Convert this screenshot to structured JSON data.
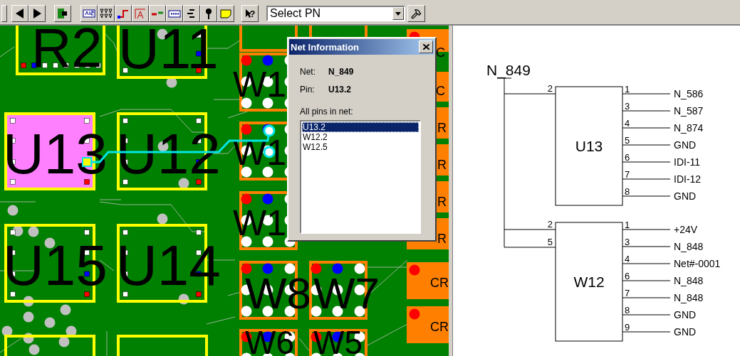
{
  "toolbar": {
    "help_glyph": "?",
    "part_select": {
      "value": "Select PN"
    }
  },
  "pcb": {
    "components": [
      {
        "label": "R2",
        "kind": "resistor_network",
        "selected": false
      },
      {
        "label": "U11",
        "kind": "ic",
        "selected": false
      },
      {
        "label": "U13",
        "kind": "ic",
        "selected": true
      },
      {
        "label": "U12",
        "kind": "ic",
        "selected": false
      },
      {
        "label": "U15",
        "kind": "ic",
        "selected": false
      },
      {
        "label": "U14",
        "kind": "ic",
        "selected": false
      },
      {
        "label": "W1",
        "kind": "header",
        "selected": false
      },
      {
        "label": "W1",
        "kind": "header",
        "selected": false
      },
      {
        "label": "W1",
        "kind": "header",
        "selected": false
      },
      {
        "label": "W8",
        "kind": "header",
        "selected": false
      },
      {
        "label": "W7",
        "kind": "header",
        "selected": false
      },
      {
        "label": "W6",
        "kind": "header",
        "selected": false
      },
      {
        "label": "W5",
        "kind": "header",
        "selected": false
      },
      {
        "label": "C",
        "kind": "diode",
        "selected": false
      },
      {
        "label": "C",
        "kind": "diode",
        "selected": false
      },
      {
        "label": "R",
        "kind": "diode",
        "selected": false
      },
      {
        "label": "R",
        "kind": "diode",
        "selected": false
      },
      {
        "label": "R",
        "kind": "diode",
        "selected": false
      },
      {
        "label": "R",
        "kind": "diode",
        "selected": false
      },
      {
        "label": "CR",
        "kind": "diode",
        "selected": false
      },
      {
        "label": "CR",
        "kind": "diode",
        "selected": false
      }
    ]
  },
  "net_dialog": {
    "title": "Net Information",
    "net_label": "Net:",
    "net": "N_849",
    "pin_label": "Pin:",
    "pin": "U13.2",
    "list_label": "All pins in net:",
    "pins": [
      {
        "name": "U13.2",
        "selected": true
      },
      {
        "name": "W12.2",
        "selected": false
      },
      {
        "name": "W12.5",
        "selected": false
      }
    ]
  },
  "schematic": {
    "net_label": "N_849",
    "parts": [
      {
        "name": "U13",
        "left_pins": [
          {
            "number": "2"
          }
        ],
        "right_pins": [
          {
            "number": "1",
            "net": "N_586"
          },
          {
            "number": "3",
            "net": "N_587"
          },
          {
            "number": "4",
            "net": "N_874"
          },
          {
            "number": "5",
            "net": "GND"
          },
          {
            "number": "6",
            "net": "IDI-11"
          },
          {
            "number": "7",
            "net": "IDI-12"
          },
          {
            "number": "8",
            "net": "GND"
          }
        ]
      },
      {
        "name": "W12",
        "left_pins": [
          {
            "number": "2"
          },
          {
            "number": "5"
          }
        ],
        "right_pins": [
          {
            "number": "1",
            "net": "+24V"
          },
          {
            "number": "3",
            "net": "N_848"
          },
          {
            "number": "4",
            "net": "Net#-0001"
          },
          {
            "number": "6",
            "net": "N_848"
          },
          {
            "number": "7",
            "net": "N_848"
          },
          {
            "number": "8",
            "net": "GND"
          },
          {
            "number": "9",
            "net": "GND"
          }
        ]
      }
    ]
  }
}
